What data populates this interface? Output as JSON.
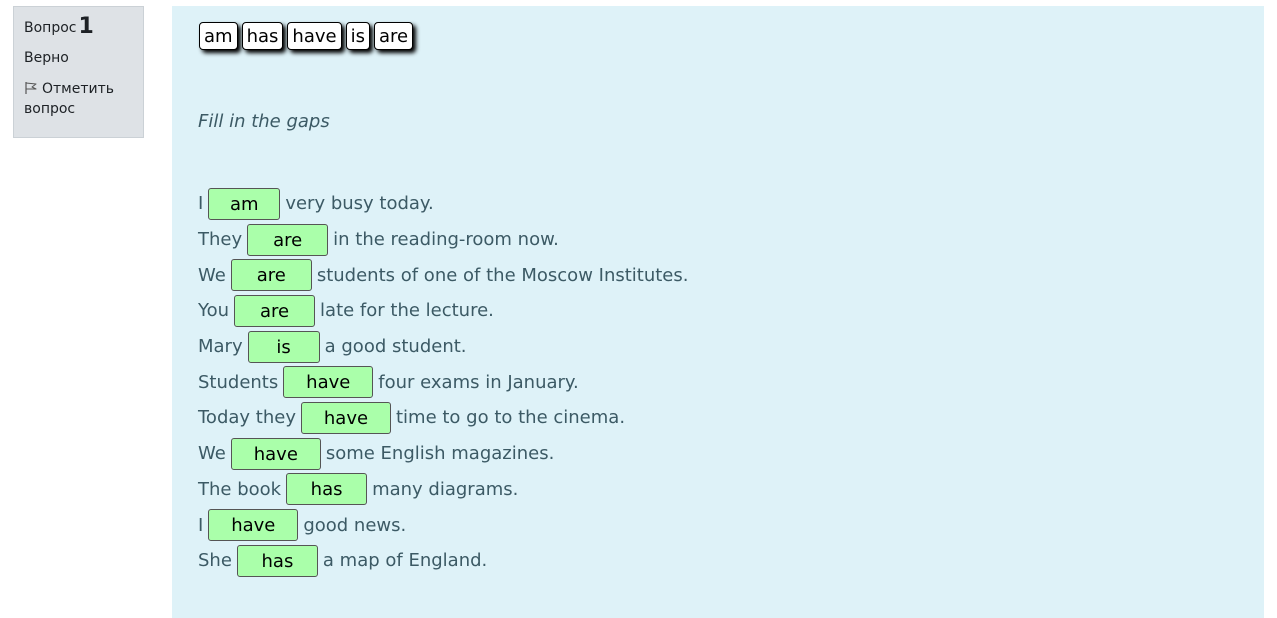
{
  "question": {
    "label": "Вопрос",
    "number": "1",
    "state": "Верно",
    "flag_label": "Отметить вопрос"
  },
  "choices": [
    "am",
    "has",
    "have",
    "is",
    "are"
  ],
  "instructions": "Fill in the gaps",
  "sentences": [
    {
      "before": "I",
      "answer": "am",
      "after": "very busy today."
    },
    {
      "before": "They",
      "answer": "are",
      "after": "in the reading-room now."
    },
    {
      "before": "We",
      "answer": "are",
      "after": "students of one of the Moscow Institutes."
    },
    {
      "before": "You",
      "answer": "are",
      "after": "late for the lecture."
    },
    {
      "before": "Mary",
      "answer": "is",
      "after": "a good student."
    },
    {
      "before": "Students",
      "answer": "have",
      "after": "four exams in January."
    },
    {
      "before": "Today they",
      "answer": "have",
      "after": "time to go to the cinema."
    },
    {
      "before": "We",
      "answer": "have",
      "after": "some English magazines."
    },
    {
      "before": "The book",
      "answer": "has",
      "after": "many diagrams."
    },
    {
      "before": "I",
      "answer": "have",
      "after": "good news."
    },
    {
      "before": "She",
      "answer": "has",
      "after": "a map of England."
    }
  ],
  "colors": {
    "gap_correct": "#aaffaa",
    "content_bg": "#def2f8",
    "info_bg": "#dee2e6",
    "text": "#3c5a65"
  },
  "icons": {
    "flag": "flag-icon"
  }
}
